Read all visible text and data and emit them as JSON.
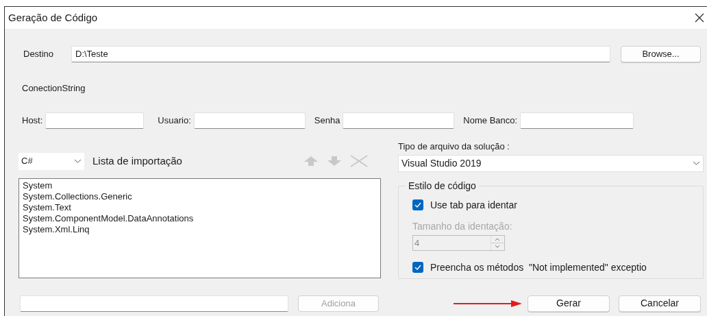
{
  "window": {
    "title": "Geração de Código"
  },
  "destination": {
    "label": "Destino",
    "value": "D:\\Teste",
    "button": "Browse..."
  },
  "connection": {
    "title": "ConectionString",
    "fields": [
      {
        "label": "Host:"
      },
      {
        "label": "Usuario:"
      },
      {
        "label": "Senha"
      },
      {
        "label": "Nome Banco:"
      }
    ]
  },
  "imports": {
    "language": "C#",
    "title": "Lista de importação",
    "tools_disabled": true,
    "items": [
      "System",
      "System.Collections.Generic",
      "System.Text",
      "System.ComponentModel.DataAnnotations",
      "System.Xml.Linq"
    ],
    "add_button": {
      "label": "Adiciona",
      "disabled": true
    }
  },
  "solution": {
    "label": "Tipo de arquivo da solução :",
    "value": "Visual Studio 2019"
  },
  "code_style": {
    "title": "Estilo de código",
    "use_tab": {
      "label": "Use tab para identar",
      "checked": true
    },
    "indent_size": {
      "label": "Tamanho da identação:",
      "value": "4",
      "disabled": true
    },
    "fill_methods": {
      "label": "Preencha os métodos  \"Not implemented\" exceptio",
      "checked": true
    }
  },
  "annotation": {
    "kind": "arrow"
  },
  "buttons": [
    {
      "label": "Gerar"
    },
    {
      "label": "Cancelar"
    }
  ]
}
